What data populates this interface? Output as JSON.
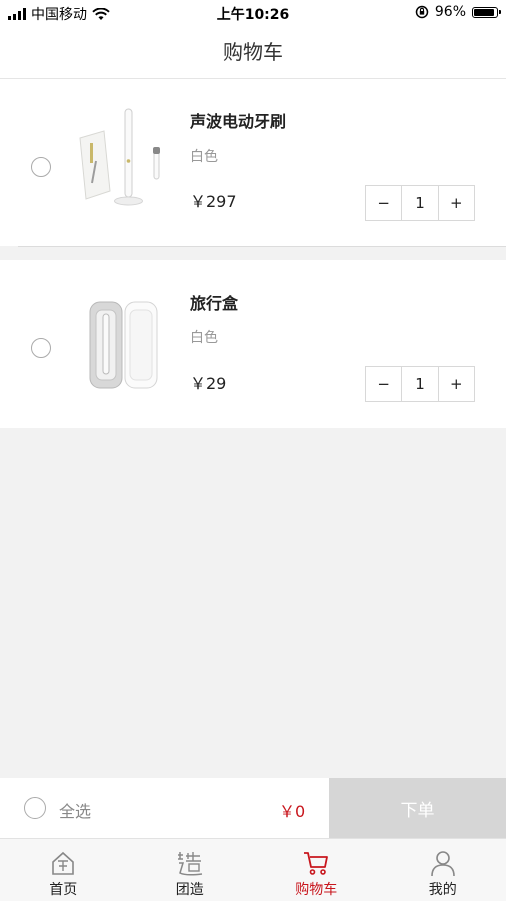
{
  "status_bar": {
    "carrier": "中国移动",
    "time": "上午10:26",
    "battery_percent": "96%",
    "battery_level": 0.96
  },
  "header": {
    "title": "购物车"
  },
  "cart": {
    "items": [
      {
        "name": "声波电动牙刷",
        "spec": "白色",
        "price": "￥297",
        "quantity": "1",
        "image": "electric-toothbrush-set",
        "selected": false
      },
      {
        "name": "旅行盒",
        "spec": "白色",
        "price": "￥29",
        "quantity": "1",
        "image": "toothbrush-travel-case",
        "selected": false
      }
    ],
    "stepper": {
      "minus": "−",
      "plus": "+"
    }
  },
  "checkout": {
    "select_all_label": "全选",
    "total": "￥0",
    "order_label": "下单"
  },
  "tabs": [
    {
      "label": "首页",
      "icon": "home-icon",
      "active": false
    },
    {
      "label": "团造",
      "icon": "build-icon",
      "active": false
    },
    {
      "label": "购物车",
      "icon": "cart-icon",
      "active": true
    },
    {
      "label": "我的",
      "icon": "user-icon",
      "active": false
    }
  ],
  "colors": {
    "accent": "#c8161d",
    "order_button_disabled": "#d6d6d6",
    "background": "#f2f2f2"
  }
}
